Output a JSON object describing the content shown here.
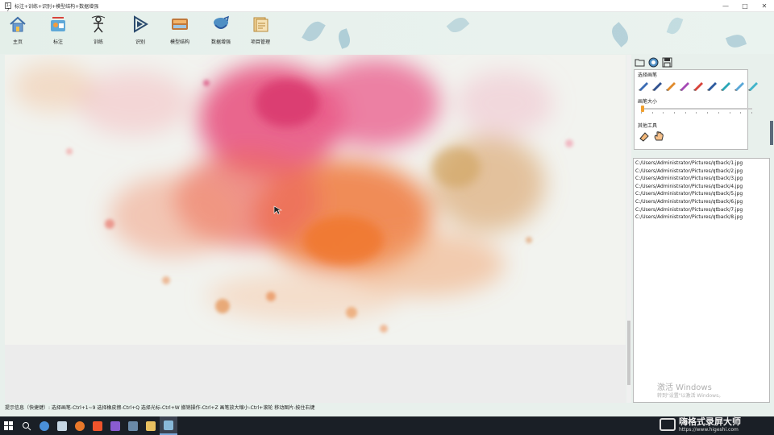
{
  "window": {
    "title": "标注+训练+识别+模型结构+数据增强",
    "icon_text": "1-7",
    "controls": [
      "minimize",
      "maximize",
      "close"
    ]
  },
  "toolbar": {
    "buttons": [
      {
        "label": "主页",
        "icon": "home-icon"
      },
      {
        "label": "标注",
        "icon": "annotate-icon"
      },
      {
        "label": "训练",
        "icon": "train-icon"
      },
      {
        "label": "识别",
        "icon": "recognize-icon"
      },
      {
        "label": "模型结构",
        "icon": "model-structure-icon"
      },
      {
        "label": "数据增强",
        "icon": "data-augment-icon"
      },
      {
        "label": "项目管理",
        "icon": "project-manage-icon"
      }
    ]
  },
  "right_panel": {
    "top_tools": [
      "open-folder-icon",
      "target-icon",
      "save-icon"
    ],
    "brush_section_title": "选择画笔",
    "brushes": [
      {
        "name": "brush-blue",
        "color": "#3d6db5"
      },
      {
        "name": "brush-navy",
        "color": "#30518f"
      },
      {
        "name": "brush-orange",
        "color": "#e08a2c"
      },
      {
        "name": "brush-purple",
        "color": "#a64bb5"
      },
      {
        "name": "brush-red",
        "color": "#d8433a"
      },
      {
        "name": "brush-dark-blue",
        "color": "#2c5a9e"
      },
      {
        "name": "brush-teal",
        "color": "#2aa7b7"
      },
      {
        "name": "brush-light-blue",
        "color": "#5aa8d8"
      },
      {
        "name": "brush-cyan",
        "color": "#41b3c9"
      }
    ],
    "size_section_title": "画笔大小",
    "brush_size_fraction": 0.0,
    "other_tools_title": "其他工具",
    "other_tools": [
      "eraser-icon",
      "hand-icon"
    ]
  },
  "file_list": [
    "C:/Users/Administrator/Pictures/qtback/1.jpg",
    "C:/Users/Administrator/Pictures/qtback/2.jpg",
    "C:/Users/Administrator/Pictures/qtback/3.jpg",
    "C:/Users/Administrator/Pictures/qtback/4.jpg",
    "C:/Users/Administrator/Pictures/qtback/5.jpg",
    "C:/Users/Administrator/Pictures/qtback/6.jpg",
    "C:/Users/Administrator/Pictures/qtback/7.jpg",
    "C:/Users/Administrator/Pictures/qtback/8.jpg"
  ],
  "status_text": "提示信息（快捷键）: 选择画笔-Ctrl+1~9    选择橡皮擦-Ctrl+Q    选择光标-Ctrl+W    撤销操作-Ctrl+Z    画笔放大缩小-Ctrl+滚轮    移动图片-按住右键",
  "activation": {
    "line1": "激活 Windows",
    "line2": "转到\"设置\"以激活 Windows。"
  },
  "taskbar": {
    "items": [
      "windows-start-icon",
      "search-icon",
      "chrome-icon",
      "cortana-icon",
      "firefox-icon",
      "brave-icon",
      "visual-studio-icon",
      "video-icon",
      "files-icon",
      "app-icon"
    ],
    "brand_name": "嗨格式录屏大师",
    "brand_url": "https://www.higeshi.com"
  },
  "colors": {
    "toolbar_bg": "#e6f0eb",
    "accent": "#f0a030",
    "taskbar_bg": "#1a1f26"
  }
}
